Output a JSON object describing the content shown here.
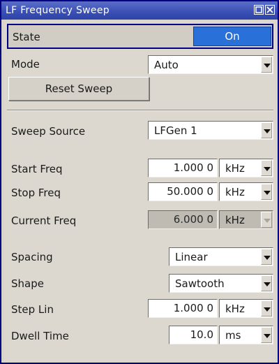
{
  "window": {
    "title": "LF Frequency Sweep"
  },
  "state": {
    "label": "State",
    "value": "On"
  },
  "mode": {
    "label": "Mode",
    "value": "Auto"
  },
  "reset": {
    "label": "Reset Sweep"
  },
  "sweep_source": {
    "label": "Sweep Source",
    "value": "LFGen 1"
  },
  "start_freq": {
    "label": "Start Freq",
    "value": "1.000 0",
    "unit": "kHz"
  },
  "stop_freq": {
    "label": "Stop Freq",
    "value": "50.000 0",
    "unit": "kHz"
  },
  "current_freq": {
    "label": "Current Freq",
    "value": "6.000 0",
    "unit": "kHz"
  },
  "spacing": {
    "label": "Spacing",
    "value": "Linear"
  },
  "shape": {
    "label": "Shape",
    "value": "Sawtooth"
  },
  "step_lin": {
    "label": "Step Lin",
    "value": "1.000 0",
    "unit": "kHz"
  },
  "dwell_time": {
    "label": "Dwell Time",
    "value": "10.0",
    "unit": "ms"
  },
  "colors": {
    "title_bar": "#3a4fb3",
    "state_on": "#2a70d9",
    "panel": "#dcd8cf",
    "readonly_field": "#bfbbb3"
  },
  "icons": [
    "restore-icon",
    "close-icon",
    "chevron-down-icon"
  ]
}
